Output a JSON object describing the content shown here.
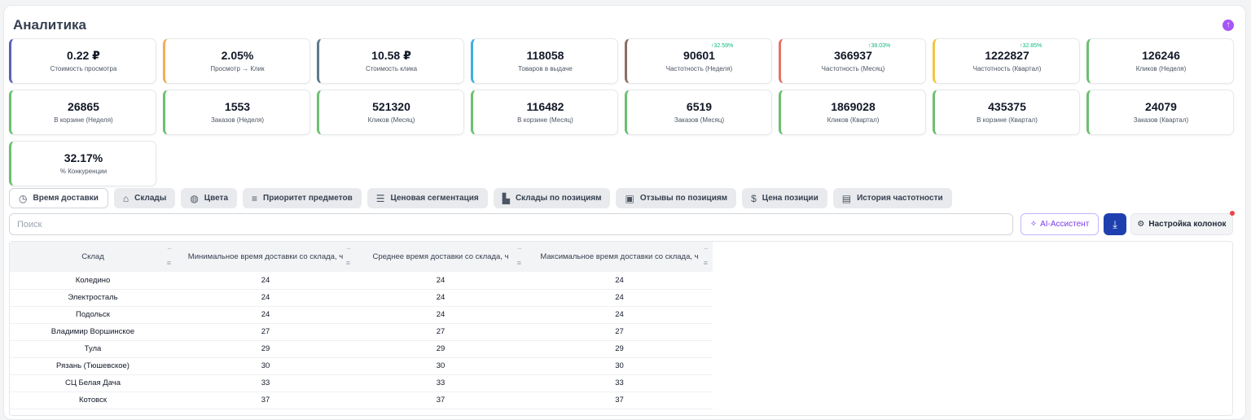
{
  "panel": {
    "title": "Аналитика"
  },
  "cards": [
    {
      "value": "0.22 ₽",
      "label": "Стоимость просмотра",
      "color": "#5b61b8",
      "delta": ""
    },
    {
      "value": "2.05%",
      "label": "Просмотр → Клик",
      "color": "#f6ad55",
      "delta": ""
    },
    {
      "value": "10.58 ₽",
      "label": "Стоимость клика",
      "color": "#5c7b8a",
      "delta": ""
    },
    {
      "value": "118058",
      "label": "Товаров в выдаче",
      "color": "#3fb0e0",
      "delta": ""
    },
    {
      "value": "90601",
      "label": "Частотность (Неделя)",
      "color": "#8d6e63",
      "delta": "↑32.59%"
    },
    {
      "value": "366937",
      "label": "Частотность (Месяц)",
      "color": "#e57368",
      "delta": "↑38.03%"
    },
    {
      "value": "1222827",
      "label": "Частотность (Квартал)",
      "color": "#f4c542",
      "delta": "↑32.85%"
    },
    {
      "value": "126246",
      "label": "Кликов (Неделя)",
      "color": "#6cc070",
      "delta": ""
    },
    {
      "value": "26865",
      "label": "В корзине (Неделя)",
      "color": "#6cc070",
      "delta": ""
    },
    {
      "value": "1553",
      "label": "Заказов (Неделя)",
      "color": "#6cc070",
      "delta": ""
    },
    {
      "value": "521320",
      "label": "Кликов (Месяц)",
      "color": "#6cc070",
      "delta": ""
    },
    {
      "value": "116482",
      "label": "В корзине (Месяц)",
      "color": "#6cc070",
      "delta": ""
    },
    {
      "value": "6519",
      "label": "Заказов (Месяц)",
      "color": "#6cc070",
      "delta": ""
    },
    {
      "value": "1869028",
      "label": "Кликов (Квартал)",
      "color": "#6cc070",
      "delta": ""
    },
    {
      "value": "435375",
      "label": "В корзине (Квартал)",
      "color": "#6cc070",
      "delta": ""
    },
    {
      "value": "24079",
      "label": "Заказов (Квартал)",
      "color": "#6cc070",
      "delta": ""
    },
    {
      "value": "32.17%",
      "label": "% Конкуренции",
      "color": "#6cc070",
      "delta": ""
    }
  ],
  "tabs": [
    {
      "label": "Время доставки",
      "icon": "clock-icon",
      "glyph": "◷",
      "active": true
    },
    {
      "label": "Склады",
      "icon": "warehouse-icon",
      "glyph": "⌂",
      "active": false
    },
    {
      "label": "Цвета",
      "icon": "palette-icon",
      "glyph": "◍",
      "active": false
    },
    {
      "label": "Приоритет предметов",
      "icon": "list-icon",
      "glyph": "≡",
      "active": false
    },
    {
      "label": "Ценовая сегментация",
      "icon": "segments-icon",
      "glyph": "☰",
      "active": false
    },
    {
      "label": "Склады по позициям",
      "icon": "factory-icon",
      "glyph": "▙",
      "active": false
    },
    {
      "label": "Отзывы по позициям",
      "icon": "review-icon",
      "glyph": "▣",
      "active": false
    },
    {
      "label": "Цена позиции",
      "icon": "price-icon",
      "glyph": "$",
      "active": false
    },
    {
      "label": "История частотности",
      "icon": "history-icon",
      "glyph": "▤",
      "active": false
    }
  ],
  "toolbar": {
    "search_placeholder": "Поиск",
    "search_value": "",
    "ai_label": "AI-Ассистент",
    "download_icon": "download-icon",
    "columns_label": "Настройка колонок"
  },
  "table": {
    "headers": [
      "Склад",
      "Минимальное время доставки со склада, ч",
      "Среднее время доставки со склада, ч",
      "Максимальное время доставки со склада, ч"
    ],
    "rows": [
      [
        "Коледино",
        "24",
        "24",
        "24"
      ],
      [
        "Электросталь",
        "24",
        "24",
        "24"
      ],
      [
        "Подольск",
        "24",
        "24",
        "24"
      ],
      [
        "Владимир Воршинское",
        "27",
        "27",
        "27"
      ],
      [
        "Тула",
        "29",
        "29",
        "29"
      ],
      [
        "Рязань (Тюшевское)",
        "30",
        "30",
        "30"
      ],
      [
        "СЦ Белая Дача",
        "33",
        "33",
        "33"
      ],
      [
        "Котовск",
        "37",
        "37",
        "37"
      ]
    ]
  }
}
